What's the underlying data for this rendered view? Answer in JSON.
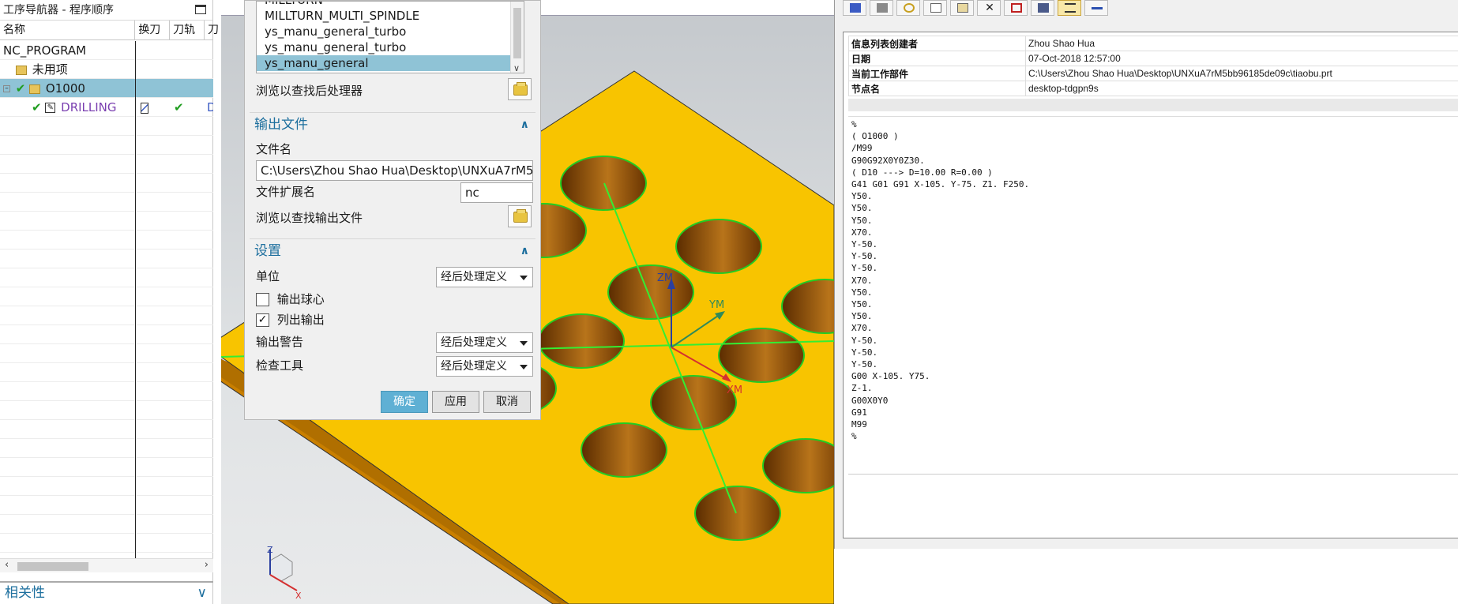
{
  "navigator": {
    "title": "工序导航器 - 程序顺序",
    "columns": [
      "名称",
      "换刀",
      "刀轨",
      "刀"
    ],
    "rows": {
      "root": "NC_PROGRAM",
      "unused": "未用项",
      "program": "O1000",
      "operation": "DRILLING",
      "operation_more": "D"
    },
    "related_panel": "相关性"
  },
  "dialog": {
    "postprocessors": [
      "MILLTURN",
      "MILLTURN_MULTI_SPINDLE",
      "ys_manu_general_turbo",
      "ys_manu_general_turbo",
      "ys_manu_general"
    ],
    "selected_postprocessor": "ys_manu_general",
    "browse_postprocessor": "浏览以查找后处理器",
    "output_section": "输出文件",
    "file_name_label": "文件名",
    "file_name_value": "C:\\Users\\Zhou Shao Hua\\Desktop\\UNXuA7rM5",
    "ext_label": "文件扩展名",
    "ext_value": "nc",
    "browse_output": "浏览以查找输出文件",
    "settings_section": "设置",
    "units_label": "单位",
    "units_value": "经后处理定义",
    "ball_center_label": "输出球心",
    "ball_center_checked": false,
    "list_output_label": "列出输出",
    "list_output_checked": true,
    "warning_label": "输出警告",
    "warning_value": "经后处理定义",
    "check_tool_label": "检查工具",
    "check_tool_value": "经后处理定义",
    "ok_label": "确定",
    "apply_label": "应用",
    "cancel_label": "取消"
  },
  "viewport": {
    "axis_labels": {
      "zm": "ZM",
      "ym": "YM",
      "xm": "XM"
    },
    "triad_labels": {
      "z": "Z",
      "x": "X"
    },
    "part_top_color": "#f8c400",
    "part_side_color": "#c97f00",
    "hole_outline_color": "#22cc22"
  },
  "info": {
    "meta": [
      {
        "key": "信息列表创建者",
        "value": "Zhou Shao Hua"
      },
      {
        "key": "日期",
        "value": "07-Oct-2018 12:57:00"
      },
      {
        "key": "当前工作部件",
        "value": "C:\\Users\\Zhou Shao Hua\\Desktop\\UNXuA7rM5bb96185de09c\\tiaobu.prt"
      },
      {
        "key": "节点名",
        "value": "desktop-tdgpn9s"
      }
    ],
    "nc_code": "%\n( O1000 )\n/M99\nG90G92X0Y0Z30.\n( D10 ---> D=10.00 R=0.00 )\nG41 G01 G91 X-105. Y-75. Z1. F250.\nY50.\nY50.\nY50.\nX70.\nY-50.\nY-50.\nY-50.\nX70.\nY50.\nY50.\nY50.\nX70.\nY-50.\nY-50.\nY-50.\nG00 X-105. Y75.\nZ-1.\nG00X0Y0\nG91\nM99\n%",
    "toolbar_icons": [
      "save-info-icon",
      "print-icon",
      "cut-icon",
      "copy-icon",
      "paste-icon",
      "delete-icon",
      "find-icon",
      "tools-icon",
      "wrap-icon",
      "minimize-icon"
    ]
  }
}
